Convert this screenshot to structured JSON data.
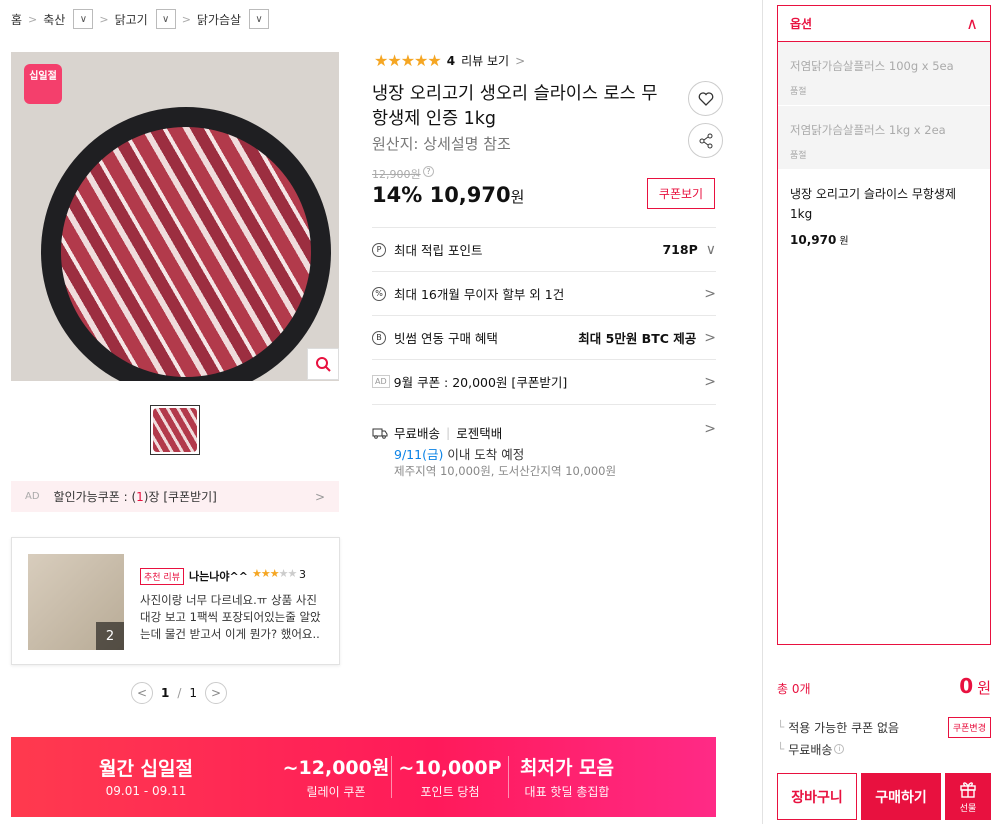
{
  "breadcrumb": {
    "home": "홈",
    "level1": "축산",
    "level2": "닭고기",
    "level3": "닭가슴살"
  },
  "gallery": {
    "badge": "십일절",
    "thumb_count": 1
  },
  "ad_coupon": {
    "ad": "AD",
    "prefix": "할인가능쿠폰 : (",
    "count": "1",
    "suffix": ")장 [쿠폰받기]"
  },
  "review_card": {
    "tag": "추천 리뷰",
    "user": "나는나야^^",
    "stars_filled": "★★★",
    "stars_empty": "★★",
    "score": "3",
    "photo_count": "2",
    "text": "사진이랑 너무 다르네요.ㅠ 상품 사진 대강 보고 1팩씩 포장되어있는줄 알았는데 물건 받고서 이게 뭔가? 했어요.. 전혀..."
  },
  "pager": {
    "current": "1",
    "sep": "/",
    "total": "1"
  },
  "product": {
    "stars": "★★★★★",
    "rating_value": 4.5,
    "review_count": "4",
    "review_link": "리뷰 보기",
    "title": "냉장 오리고기 생오리 슬라이스 로스 무항생제 인증 1kg",
    "origin": "원산지: 상세설명 참조",
    "original_price": "12,900원",
    "discount": "14%",
    "price": "10,970",
    "price_unit": "원",
    "coupon_button": "쿠폰보기"
  },
  "rows": {
    "point_label": "최대 적립 포인트",
    "point_value": "718P",
    "installment_label": "최대 16개월 무이자 할부 외 1건",
    "btc_label": "빗썸 연동 구매 혜택",
    "btc_value": "최대 5만원 BTC 제공",
    "ad_tag": "AD",
    "coupon_row": "9월 쿠폰 : 20,000원 [쿠폰받기]"
  },
  "shipping": {
    "free": "무료배송",
    "carrier": "로젠택배",
    "arrival_date": "9/11(금)",
    "arrival_text": "이내 도착 예정",
    "extra": "제주지역 10,000원, 도서산간지역 10,000원"
  },
  "banner": {
    "title": "월간 십일절",
    "dates": "09.01 - 09.11",
    "b1_big": "~12,000원",
    "b1_small": "릴레이 쿠폰",
    "b2_big": "~10,000P",
    "b2_small": "포인트 당첨",
    "b3_big": "최저가 모음",
    "b3_small": "대표 핫딜 총집합"
  },
  "options": {
    "header": "옵션",
    "items": [
      {
        "name": "저염닭가슴살플러스 100g x 5ea",
        "status": "품절"
      },
      {
        "name": "저염닭가슴살플러스 1kg x 2ea",
        "status": "품절"
      }
    ],
    "selected_name": "냉장 오리고기 슬라이스 무항생제 1kg",
    "selected_price": "10,970",
    "selected_unit": "원"
  },
  "summary": {
    "total_label": "총 0개",
    "total_value": "0",
    "total_unit": "원",
    "coupon_note": "적용 가능한 쿠폰 없음",
    "coupon_change": "쿠폰변경",
    "shipping_note": "무료배송"
  },
  "actions": {
    "cart": "장바구니",
    "buy": "구매하기",
    "gift": "선물"
  },
  "colors": {
    "accent": "#e8113f",
    "star": "#f5a623",
    "link_blue": "#0b83e6"
  }
}
